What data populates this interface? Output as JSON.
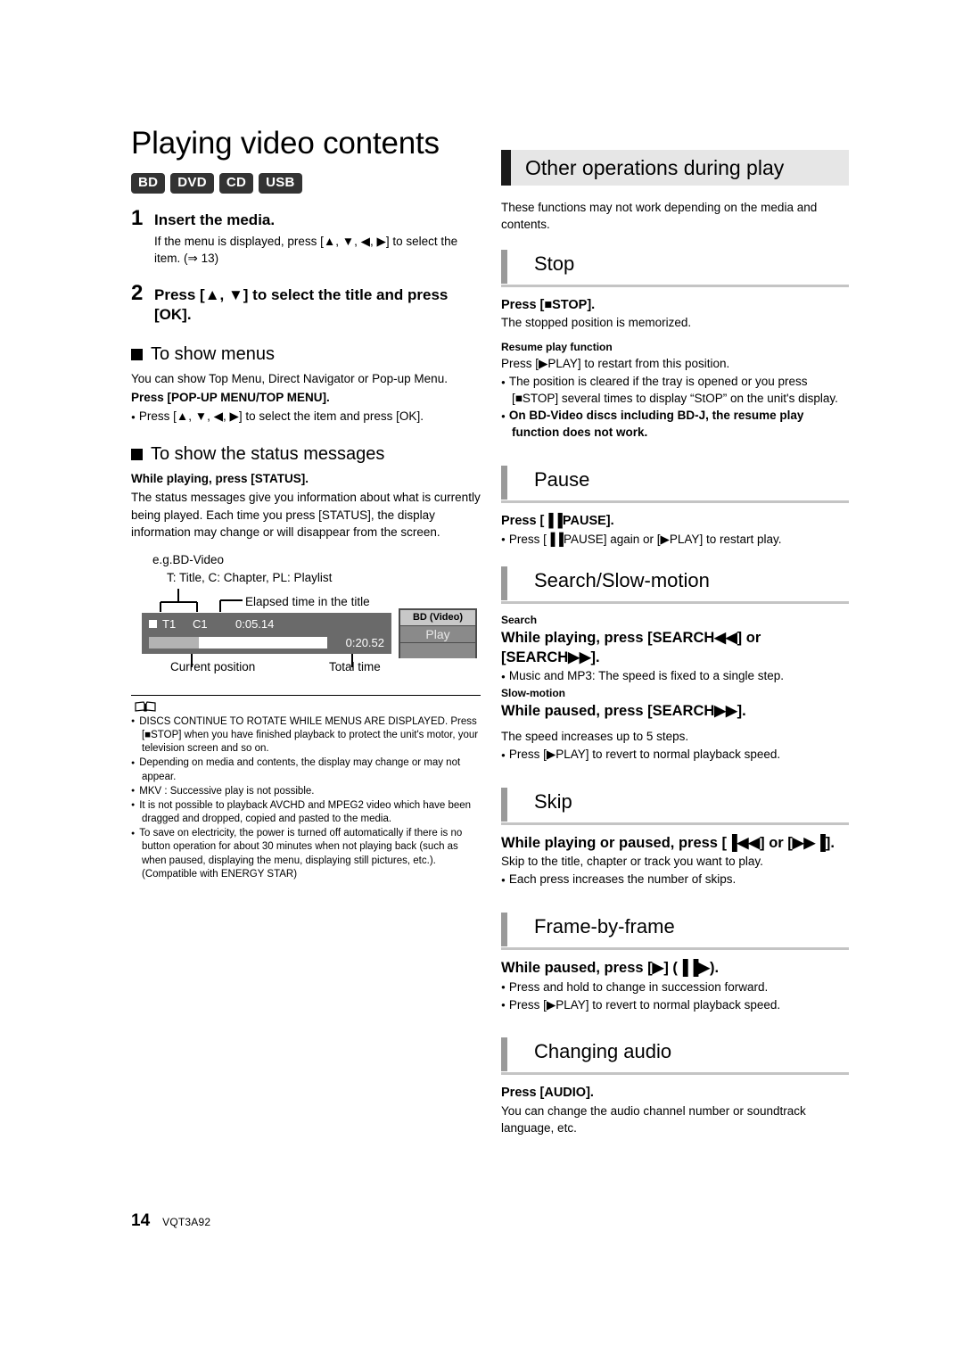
{
  "page": {
    "number": "14",
    "doc_code": "VQT3A92"
  },
  "left": {
    "title": "Playing video contents",
    "media_badges": [
      "BD",
      "DVD",
      "CD",
      "USB"
    ],
    "steps": [
      {
        "num": "1",
        "heading": "Insert the media.",
        "body": "If the menu is displayed, press [▲, ▼, ◀, ▶] to select the item. (⇒ 13)"
      },
      {
        "num": "2",
        "heading": "Press [▲, ▼] to select the title and press [OK].",
        "body": ""
      }
    ],
    "show_menus": {
      "heading": "To show menus",
      "line1": "You can show Top Menu, Direct Navigator or Pop-up Menu.",
      "line2": "Press [POP-UP MENU/TOP MENU].",
      "bullet1": "Press [▲, ▼, ◀, ▶] to select the item and press [OK]."
    },
    "status_messages": {
      "heading": "To show the status messages",
      "line1": "While playing, press [STATUS].",
      "line2": "The status messages give you information about what is currently being played. Each time you press [STATUS], the display information may change or will disappear from the screen."
    },
    "diagram": {
      "example_label": "e.g.BD-Video",
      "legend": "T: Title, C: Chapter, PL: Playlist",
      "callout_elapsed": "Elapsed time in the title",
      "callout_current_position": "Current position",
      "callout_total_time": "Total time",
      "osd": {
        "title_marker": "T1",
        "chapter_marker": "C1",
        "elapsed_time": "0:05.14",
        "total_time": "0:20.52"
      },
      "status_box": {
        "media": "BD (Video)",
        "state": "Play"
      }
    },
    "notes": [
      "DISCS CONTINUE TO ROTATE WHILE MENUS ARE DISPLAYED. Press [■STOP] when you have finished playback to protect the unit's motor, your television screen and so on.",
      "Depending on media and contents, the display may change or may not appear.",
      "MKV : Successive play is not possible.",
      "It is not possible to playback AVCHD and MPEG2 video which have been dragged and dropped, copied and pasted to the media.",
      "To save on electricity, the power is turned off automatically if there is no button operation for about 30 minutes when not playing back (such as when paused, displaying the menu, displaying still pictures, etc.). (Compatible with ENERGY STAR)"
    ]
  },
  "right": {
    "main_heading": "Other operations during play",
    "intro": "These functions may not work depending on the media and contents.",
    "sections": [
      {
        "heading": "Stop",
        "press_label": "Press [■STOP].",
        "line1": "The stopped position is memorized.",
        "resume_heading": "Resume play function",
        "resume_line": "Press [▶PLAY] to restart from this position.",
        "bullet1": "The position is cleared if the tray is opened or you press [■STOP] several times to display “StOP” on the unit's display.",
        "bullet2": "On BD-Video discs including BD-J, the resume play function does not work."
      },
      {
        "heading": "Pause",
        "press_label": "Press [▐▐PAUSE].",
        "bullet1": "Press [▐▐PAUSE] again or [▶PLAY] to restart play."
      },
      {
        "heading": "Search/Slow-motion",
        "search_label": "Search",
        "search_press": "While playing, press [SEARCH◀◀] or [SEARCH▶▶].",
        "search_bullet": "Music and MP3: The speed is fixed to a single step.",
        "slow_label": "Slow-motion",
        "slow_press": "While paused, press [SEARCH▶▶].",
        "slow_line": "The speed increases up to 5 steps.",
        "slow_bullet": "Press [▶PLAY] to revert to normal playback speed."
      },
      {
        "heading": "Skip",
        "press_label": "While playing or paused, press [▐◀◀] or [▶▶▐].",
        "line1": "Skip to the title, chapter or track you want to play.",
        "bullet1": "Each press increases the number of skips."
      },
      {
        "heading": "Frame-by-frame",
        "press_label": "While paused, press [▶] (▐▐▶).",
        "bullet1": "Press and hold to change in succession forward.",
        "bullet2": "Press [▶PLAY] to revert to normal playback speed."
      },
      {
        "heading": "Changing audio",
        "press_label": "Press [AUDIO].",
        "line1": "You can change the audio channel number or soundtrack language, etc."
      }
    ]
  }
}
